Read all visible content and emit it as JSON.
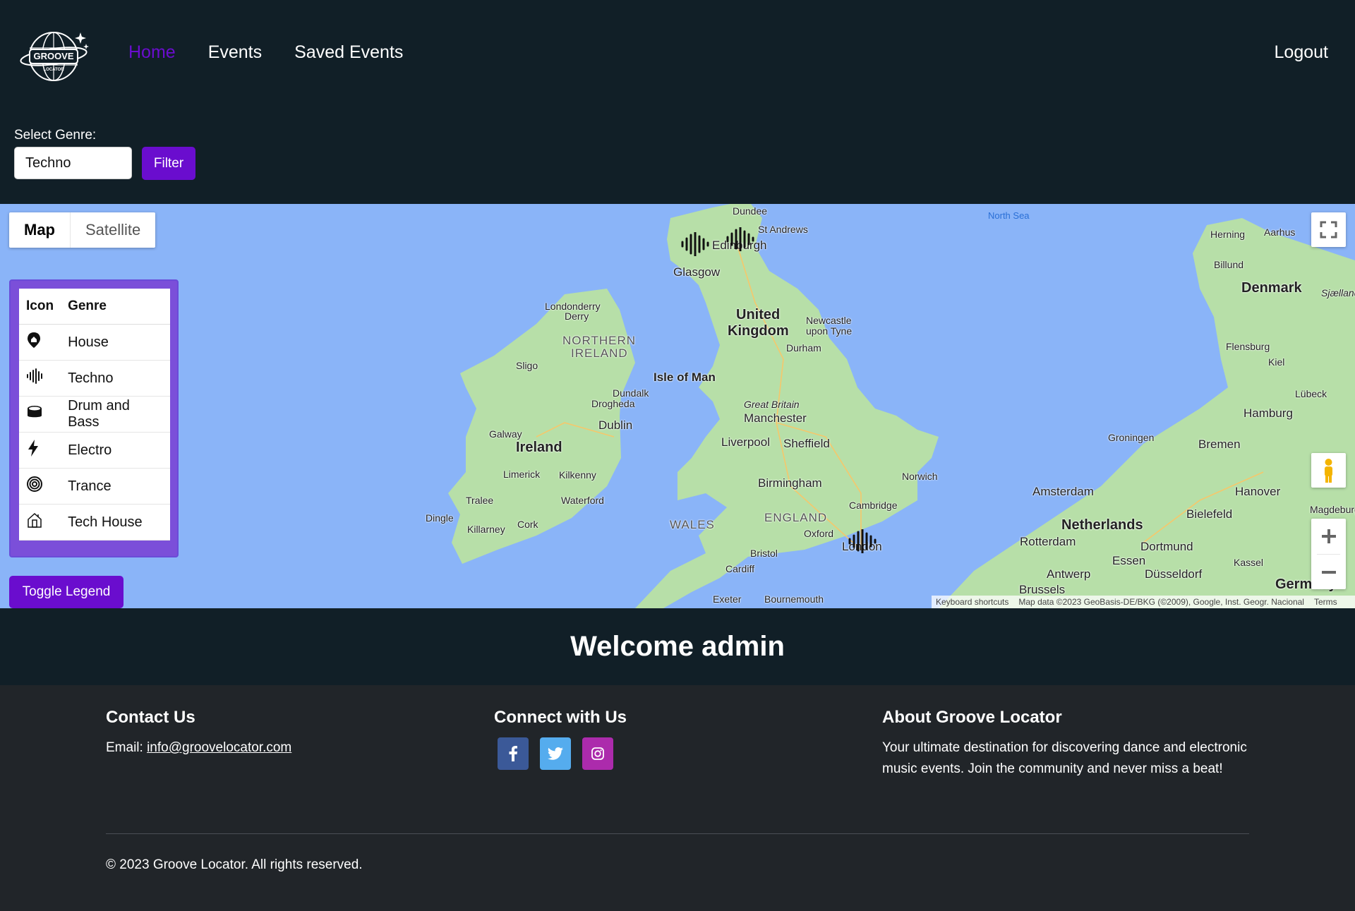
{
  "nav": {
    "logo_text": "GROOVE",
    "logo_sub": "LOCATOR",
    "links": [
      "Home",
      "Events",
      "Saved Events"
    ],
    "active": "Home",
    "logout": "Logout"
  },
  "filter": {
    "label": "Select Genre:",
    "value": "Techno",
    "button": "Filter"
  },
  "map": {
    "type_buttons": [
      "Map",
      "Satellite"
    ],
    "active_type": "Map",
    "labels": {
      "north_sea": "North Sea",
      "dundee": "Dundee",
      "st_andrews": "St Andrews",
      "edinburgh": "Edinburgh",
      "glasgow": "Glasgow",
      "united": "United",
      "kingdom": "Kingdom",
      "newcastle1": "Newcastle",
      "newcastle2": "upon Tyne",
      "durham": "Durham",
      "londonderry1": "Londonderry",
      "londonderry2": "Derry",
      "northern": "NORTHERN",
      "ireland_n": "IRELAND",
      "isle_of_man": "Isle of Man",
      "sligo": "Sligo",
      "dundalk": "Dundalk",
      "drogheda": "Drogheda",
      "dublin": "Dublin",
      "galway": "Galway",
      "ireland": "Ireland",
      "limerick": "Limerick",
      "kilkenny": "Kilkenny",
      "tralee": "Tralee",
      "waterford": "Waterford",
      "dingle": "Dingle",
      "killarney": "Killarney",
      "cork": "Cork",
      "great_britain": "Great Britain",
      "manchester": "Manchester",
      "liverpool": "Liverpool",
      "sheffield": "Sheffield",
      "birmingham": "Birmingham",
      "norwich": "Norwich",
      "cambridge": "Cambridge",
      "wales": "WALES",
      "england": "ENGLAND",
      "oxford": "Oxford",
      "london": "London",
      "bristol": "Bristol",
      "cardiff": "Cardiff",
      "exeter": "Exeter",
      "bournemouth": "Bournemouth",
      "herning": "Herning",
      "aarhus": "Aarhus",
      "billund": "Billund",
      "denmark": "Denmark",
      "sjaelland": "Sjælland",
      "flensburg": "Flensburg",
      "kiel": "Kiel",
      "lubeck": "Lübeck",
      "hamburg": "Hamburg",
      "groningen": "Groningen",
      "bremen": "Bremen",
      "amsterdam": "Amsterdam",
      "hanover": "Hanover",
      "netherlands": "Netherlands",
      "bielefeld": "Bielefeld",
      "magdeburg": "Magdeburg",
      "rotterdam": "Rotterdam",
      "dortmund": "Dortmund",
      "essen": "Essen",
      "kassel": "Kassel",
      "antwerp": "Antwerp",
      "dusseldorf": "Düsseldorf",
      "brussels": "Brussels",
      "germany": "Germany"
    },
    "attribution": {
      "shortcuts": "Keyboard shortcuts",
      "data": "Map data ©2023 GeoBasis-DE/BKG (©2009), Google, Inst. Geogr. Nacional",
      "terms": "Terms"
    }
  },
  "legend": {
    "headers": [
      "Icon",
      "Genre"
    ],
    "rows": [
      {
        "icon": "house-pin-icon",
        "genre": "House"
      },
      {
        "icon": "soundwave-icon",
        "genre": "Techno"
      },
      {
        "icon": "drum-icon",
        "genre": "Drum and Bass"
      },
      {
        "icon": "lightning-icon",
        "genre": "Electro"
      },
      {
        "icon": "spiral-icon",
        "genre": "Trance"
      },
      {
        "icon": "tech-house-icon",
        "genre": "Tech House"
      }
    ],
    "toggle": "Toggle Legend"
  },
  "welcome": "Welcome admin",
  "footer": {
    "contact_title": "Contact Us",
    "email_label": "Email: ",
    "email": "info@groovelocator.com",
    "connect_title": "Connect with Us",
    "social": [
      {
        "icon": "facebook-icon",
        "color": "#3b5998"
      },
      {
        "icon": "twitter-icon",
        "color": "#55acee"
      },
      {
        "icon": "instagram-icon",
        "color": "#ac2bac"
      }
    ],
    "about_title": "About Groove Locator",
    "about_text": "Your ultimate destination for discovering dance and electronic music events. Join the community and never miss a beat!",
    "copyright": "© 2023 Groove Locator. All rights reserved."
  },
  "colors": {
    "accent": "#6a0dce",
    "page_bg": "#111f27",
    "footer_bg": "#212529",
    "legend_bg": "#7b4fd9",
    "water": "#8ab4f8",
    "land": "#b7dfa8"
  }
}
